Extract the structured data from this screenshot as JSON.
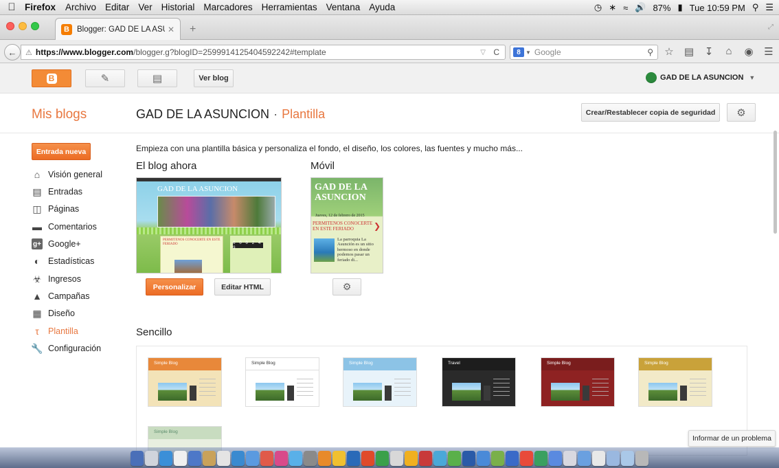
{
  "menubar": {
    "app": "Firefox",
    "items": [
      "Archivo",
      "Editar",
      "Ver",
      "Historial",
      "Marcadores",
      "Herramientas",
      "Ventana",
      "Ayuda"
    ],
    "battery": "87%",
    "clock": "Tue 10:59 PM"
  },
  "browser": {
    "tab_title": "Blogger: GAD DE LA ASUN...",
    "url_host": "https://www.blogger.com",
    "url_path": "/blogger.g?blogID=2599914125404592242#template",
    "search_placeholder": "Google"
  },
  "blogger_bar": {
    "view_blog": "Ver blog",
    "user": "GAD DE LA ASUNCION"
  },
  "header": {
    "my_blogs": "Mis blogs",
    "blog_name": "GAD DE LA ASUNCION",
    "separator": "·",
    "section": "Plantilla",
    "backup_button": "Crear/Restablecer copia de seguridad"
  },
  "sidebar": {
    "new_post": "Entrada nueva",
    "items": [
      {
        "label": "Visión general",
        "icon": "home-icon"
      },
      {
        "label": "Entradas",
        "icon": "posts-icon"
      },
      {
        "label": "Páginas",
        "icon": "pages-icon"
      },
      {
        "label": "Comentarios",
        "icon": "comments-icon"
      },
      {
        "label": "Google+",
        "icon": "google-plus-icon"
      },
      {
        "label": "Estadísticas",
        "icon": "stats-icon"
      },
      {
        "label": "Ingresos",
        "icon": "trophy-icon"
      },
      {
        "label": "Campañas",
        "icon": "campaigns-icon"
      },
      {
        "label": "Diseño",
        "icon": "layout-icon"
      },
      {
        "label": "Plantilla",
        "icon": "template-icon",
        "active": true
      },
      {
        "label": "Configuración",
        "icon": "wrench-icon"
      }
    ]
  },
  "main": {
    "intro": "Empieza con una plantilla básica y personaliza el fondo, el diseño, los colores, las fuentes y mucho más...",
    "blog_now": "El blog ahora",
    "mobile": "Móvil",
    "customize": "Personalizar",
    "edit_html": "Editar HTML",
    "simple": "Sencillo",
    "preview_now": {
      "title": "GAD DE LA ASUNCION",
      "post_title": "PERMITENOS CONOCERTE EN ESTE FERIADO",
      "counter": "0 0 0 2 4 9"
    },
    "preview_mobile": {
      "title": "GAD DE LA ASUNCION",
      "date": "Jueves, 12 de febrero de 2015",
      "post_title": "PERMITENOS CONOCERTE EN ESTE FERIADO",
      "excerpt": "La parroquia La Asunción es un sitio hermoso en donde podemos pasar un feriado di..."
    },
    "templates": [
      {
        "name": "Simple Blog",
        "color": "#e8883a",
        "bg": "#f3e3b8"
      },
      {
        "name": "Simple Blog",
        "color": "#ffffff",
        "bg": "#ffffff"
      },
      {
        "name": "Simple Blog",
        "color": "#8cc3e6",
        "bg": "#e8f3fa"
      },
      {
        "name": "Travel",
        "color": "#2a2a2a",
        "bg": "#2a2a2a"
      },
      {
        "name": "Simple Blog",
        "color": "#7a1d1d",
        "bg": "#8e2222"
      },
      {
        "name": "Simple Blog",
        "color": "#c9a23a",
        "bg": "#f2eac8"
      },
      {
        "name": "Simple Blog",
        "color": "#c8dcc0",
        "bg": "#e8efe0"
      }
    ]
  },
  "report_problem": "Informar de un problema"
}
